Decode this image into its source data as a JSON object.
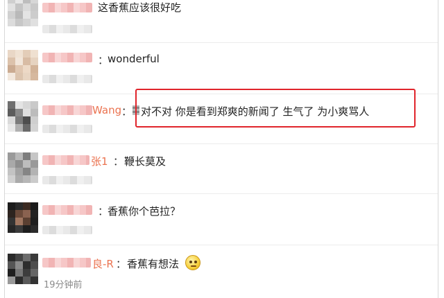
{
  "comments": [
    {
      "name_suffix": "",
      "colon": "",
      "text": "这香蕉应该很好吃"
    },
    {
      "name_suffix": "",
      "colon": "：",
      "text": "wonderful"
    },
    {
      "name_suffix": "Wang",
      "colon": "：",
      "text": "对不对 你是看到郑爽的新闻了 生气了 为小爽骂人"
    },
    {
      "name_suffix": "张1",
      "colon": "：",
      "text": "鞭长莫及"
    },
    {
      "name_suffix": "",
      "colon": "：",
      "text": "香蕉你个芭拉？"
    },
    {
      "name_suffix": "良-R",
      "colon": "：",
      "text": "香蕉有想法",
      "time": "19分钟前"
    }
  ],
  "colors": {
    "highlight": "#e0242b",
    "username": "#eb7350"
  },
  "icons": [
    "thinking-emoji-icon"
  ]
}
